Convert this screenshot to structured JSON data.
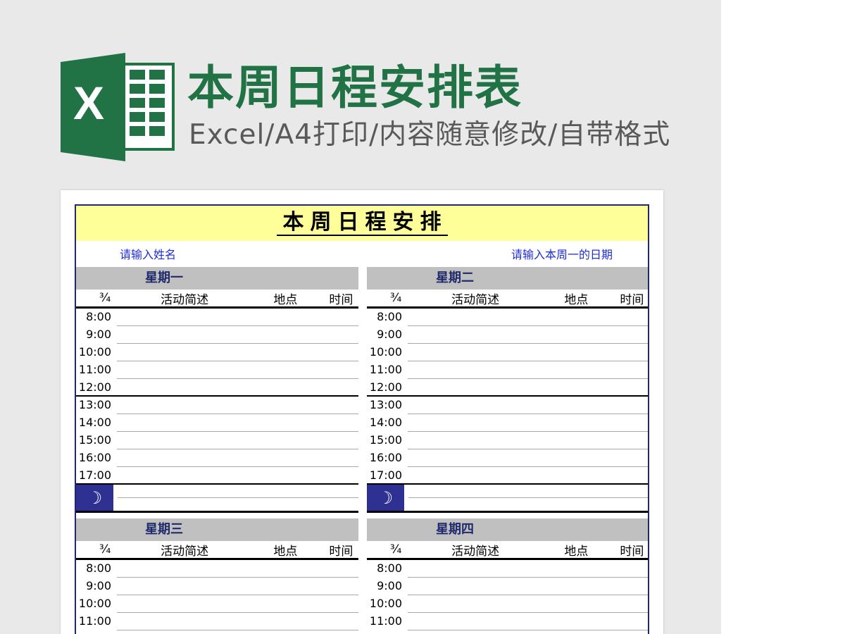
{
  "header": {
    "title": "本周日程安排表",
    "subtitle": "Excel/A4打印/内容随意修改/自带格式",
    "logo_letter": "X",
    "logo_icon": "excel-logo-icon",
    "accent_color": "#217346"
  },
  "sheet": {
    "title": "本周日程安排",
    "name_placeholder": "请输入姓名",
    "date_placeholder": "请输入本周一的日期",
    "columns": {
      "time": "¾",
      "desc": "活动简述",
      "place": "地点",
      "when": "时间"
    },
    "evening_icon": "moon-icon",
    "evening_glyph": "☽",
    "colors": {
      "title_bg": "#ffff99",
      "day_header_bg": "#c0c0c0",
      "day_header_text": "#1f2a6b",
      "evening_bg": "#2e3192",
      "info_text": "#1f2ed6"
    }
  },
  "days": [
    {
      "label": "星期一",
      "times": [
        "8:00",
        "9:00",
        "10:00",
        "11:00",
        "12:00",
        "13:00",
        "14:00",
        "15:00",
        "16:00",
        "17:00"
      ]
    },
    {
      "label": "星期二",
      "times": [
        "8:00",
        "9:00",
        "10:00",
        "11:00",
        "12:00",
        "13:00",
        "14:00",
        "15:00",
        "16:00",
        "17:00"
      ]
    },
    {
      "label": "星期三",
      "times": [
        "8:00",
        "9:00",
        "10:00",
        "11:00"
      ]
    },
    {
      "label": "星期四",
      "times": [
        "8:00",
        "9:00",
        "10:00",
        "11:00"
      ]
    }
  ]
}
